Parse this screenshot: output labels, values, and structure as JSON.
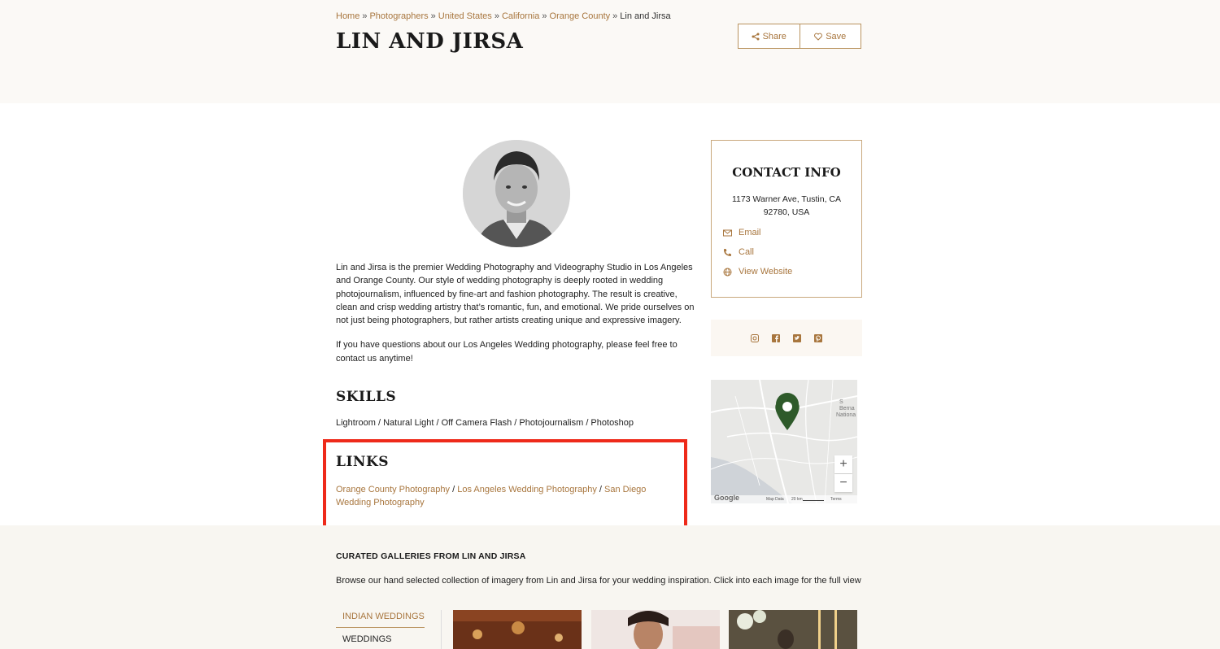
{
  "breadcrumb": {
    "items": [
      "Home",
      "Photographers",
      "United States",
      "California",
      "Orange County"
    ],
    "current": "Lin and Jirsa",
    "separator": "»"
  },
  "page_title": "LIN AND JIRSA",
  "actions": {
    "share": "Share",
    "save": "Save"
  },
  "bio": [
    "Lin and Jirsa is the premier Wedding Photography and Videography Studio in Los Angeles and Orange County. Our style of wedding photography is deeply rooted in wedding photojournalism, influenced by fine-art and fashion photography. The result is creative, clean and crisp wedding artistry that’s romantic, fun, and emotional. We pride ourselves on not just being photographers, but rather artists creating unique and expressive imagery.",
    "If you have questions about our Los Angeles Wedding photography, please feel free to contact us anytime!"
  ],
  "skills": {
    "heading": "SKILLS",
    "text": "Lightroom / Natural Light / Off Camera Flash / Photojournalism / Photoshop"
  },
  "links": {
    "heading": "LINKS",
    "items": [
      "Orange County Photography",
      "Los Angeles Wedding Photography",
      "San Diego Wedding Photography"
    ],
    "separator": " / "
  },
  "contact": {
    "heading": "CONTACT INFO",
    "address": "1173 Warner Ave, Tustin, CA 92780, USA",
    "email": "Email",
    "call": "Call",
    "website": "View Website"
  },
  "social_icons": [
    "instagram-icon",
    "facebook-icon",
    "twitter-icon",
    "pinterest-icon"
  ],
  "map": {
    "label_lines": [
      "S",
      "Berna",
      "Nationa"
    ],
    "zoom_in": "+",
    "zoom_out": "−",
    "google": "Google",
    "map_data": "Map Data",
    "scale": "20 km",
    "terms": "Terms"
  },
  "galleries": {
    "heading": "CURATED GALLERIES FROM LIN AND JIRSA",
    "description": "Browse our hand selected collection of imagery from Lin and Jirsa for your wedding inspiration. Click into each image for the full view",
    "tabs": [
      "INDIAN WEDDINGS",
      "WEDDINGS"
    ]
  },
  "colors": {
    "accent": "#a8763e",
    "highlight_border": "#ee2a1a",
    "map_pin": "#2e5a2a",
    "hero_bg": "#fbf9f6"
  }
}
